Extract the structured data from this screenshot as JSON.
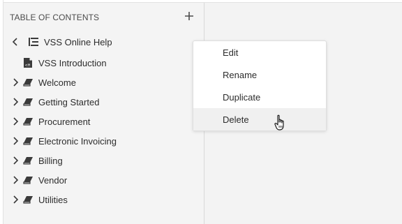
{
  "toc": {
    "header": "TABLE OF CONTENTS",
    "add_icon": "plus-icon",
    "root": {
      "label": "VSS Online Help",
      "icon": "document-tree-icon",
      "expanded": true
    },
    "intro": {
      "label": "VSS Introduction",
      "icon": "html-file-icon"
    },
    "items": [
      {
        "label": "Welcome"
      },
      {
        "label": "Getting Started"
      },
      {
        "label": "Procurement"
      },
      {
        "label": "Electronic Invoicing"
      },
      {
        "label": "Billing"
      },
      {
        "label": "Vendor"
      },
      {
        "label": "Utilities"
      }
    ]
  },
  "context_menu": {
    "items": [
      {
        "label": "Edit"
      },
      {
        "label": "Rename"
      },
      {
        "label": "Duplicate"
      },
      {
        "label": "Delete",
        "hovered": true
      }
    ]
  }
}
